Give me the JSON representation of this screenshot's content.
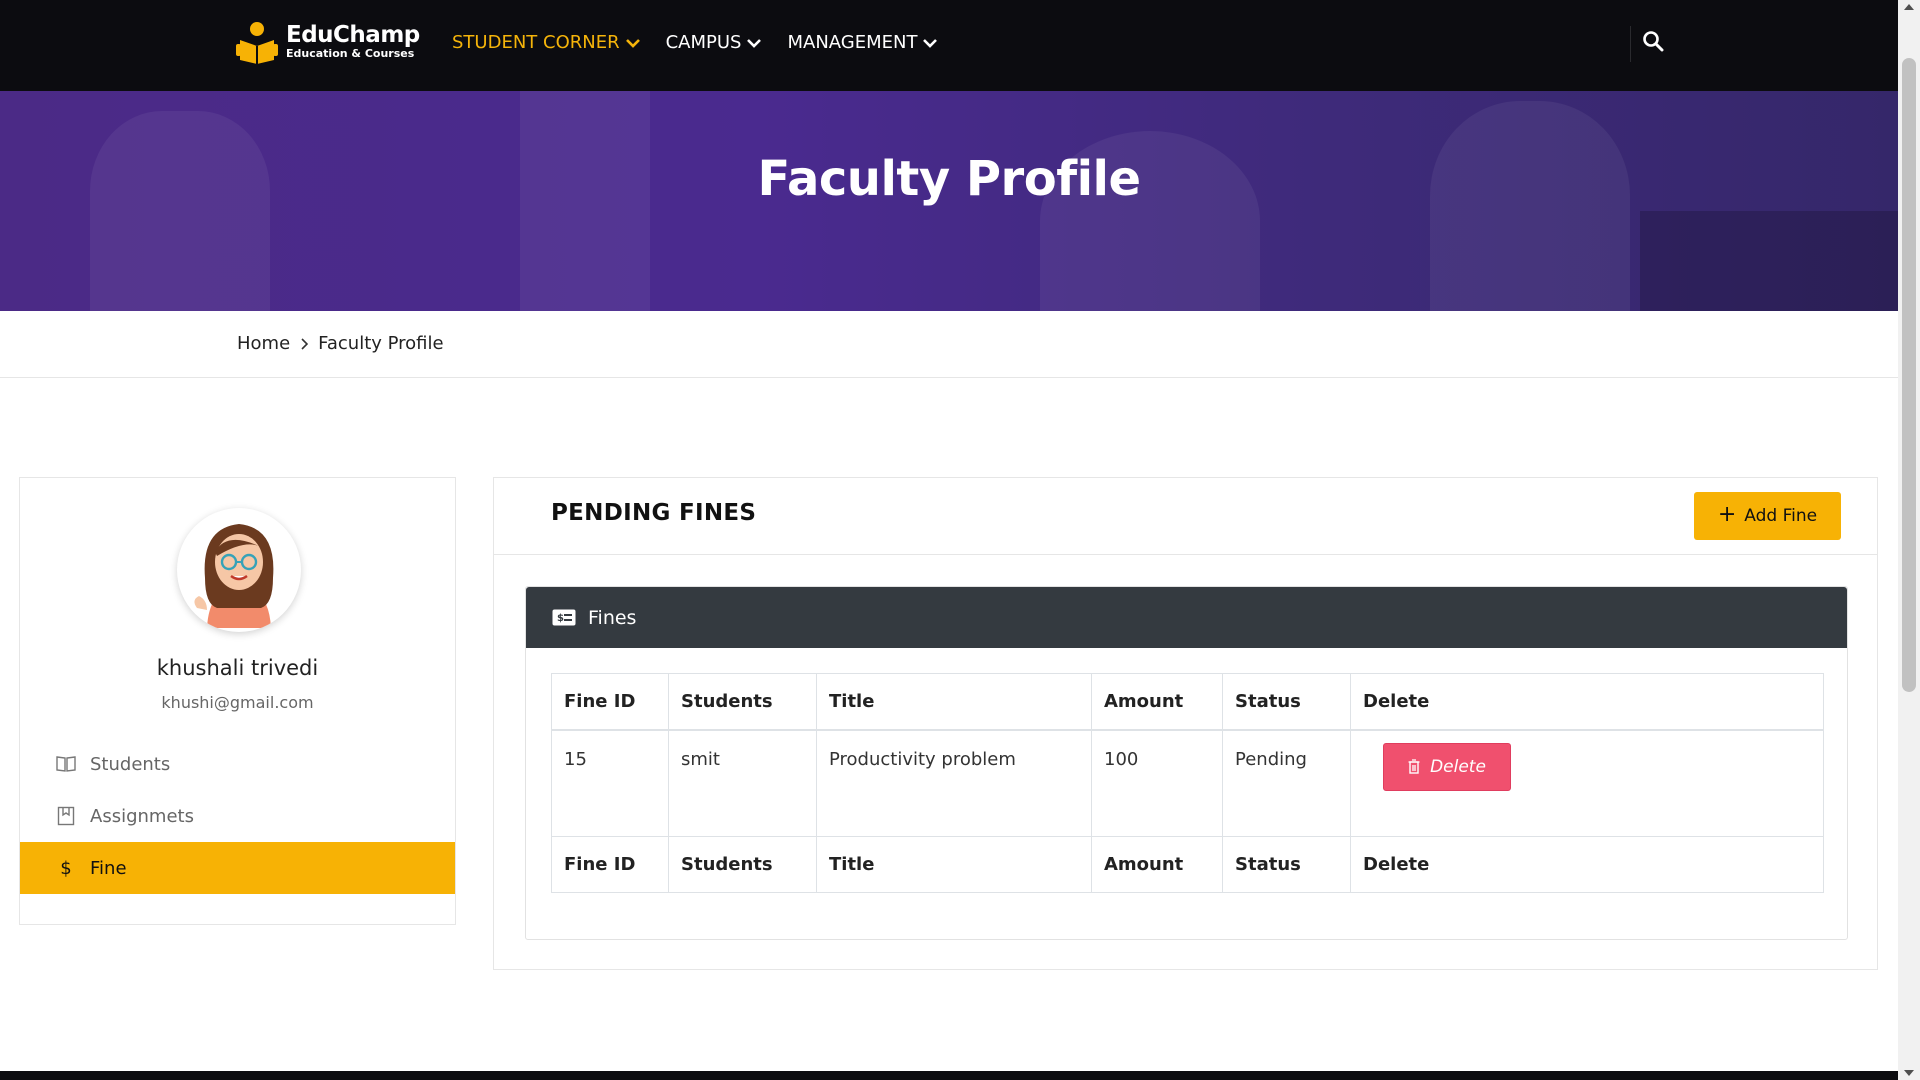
{
  "brand": {
    "name": "EduChamp",
    "tagline": "Education & Courses",
    "accent": "#f7b205",
    "dark": "#0c0c10"
  },
  "nav": {
    "items": [
      {
        "label": "STUDENT CORNER",
        "active": true
      },
      {
        "label": "CAMPUS",
        "active": false
      },
      {
        "label": "MANAGEMENT",
        "active": false
      }
    ],
    "search_icon": "search-icon"
  },
  "hero": {
    "title": "Faculty Profile"
  },
  "breadcrumb": {
    "home": "Home",
    "current": "Faculty Profile"
  },
  "profile": {
    "name": "khushali trivedi",
    "email": "khushi@gmail.com",
    "menu": [
      {
        "label": "Students",
        "icon": "book-icon",
        "active": false
      },
      {
        "label": "Assignmets",
        "icon": "bookmark-icon",
        "active": false
      },
      {
        "label": "Fine",
        "icon": "dollar-icon",
        "active": true
      }
    ]
  },
  "panel": {
    "title": "PENDING FINES",
    "add_button": "Add Fine",
    "card_title": "Fines",
    "columns": [
      "Fine ID",
      "Students",
      "Title",
      "Amount",
      "Status",
      "Delete"
    ],
    "rows": [
      {
        "id": "15",
        "student": "smit",
        "title": "Productivity problem",
        "amount": "100",
        "status": "Pending",
        "action": "Delete"
      }
    ],
    "delete_color": "#f0506e"
  }
}
